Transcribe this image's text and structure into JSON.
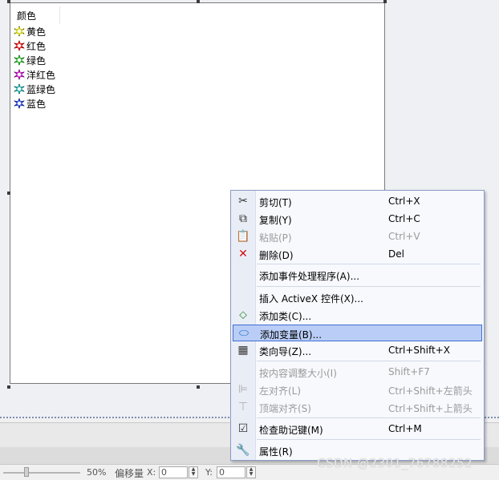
{
  "listbox": {
    "header": "颜色",
    "items": [
      {
        "label": "黄色",
        "color": "#c8c800"
      },
      {
        "label": "红色",
        "color": "#d00000"
      },
      {
        "label": "绿色",
        "color": "#1ea01e"
      },
      {
        "label": "洋红色",
        "color": "#b000b0"
      },
      {
        "label": "蓝绿色",
        "color": "#109898"
      },
      {
        "label": "蓝色",
        "color": "#1030c0"
      }
    ]
  },
  "context_menu": {
    "items": [
      {
        "label": "剪切(T)",
        "shortcut": "Ctrl+X",
        "icon": "scissors-icon",
        "enabled": true
      },
      {
        "label": "复制(Y)",
        "shortcut": "Ctrl+C",
        "icon": "copy-icon",
        "enabled": true
      },
      {
        "label": "粘贴(P)",
        "shortcut": "Ctrl+V",
        "icon": "paste-icon",
        "enabled": false
      },
      {
        "label": "删除(D)",
        "shortcut": "Del",
        "icon": "delete-x-icon",
        "enabled": true
      },
      {
        "label": "添加事件处理程序(A)...",
        "shortcut": "",
        "icon": "",
        "enabled": true
      },
      {
        "label": "插入 ActiveX 控件(X)...",
        "shortcut": "",
        "icon": "",
        "enabled": true
      },
      {
        "label": "添加类(C)...",
        "shortcut": "",
        "icon": "add-class-icon",
        "enabled": true
      },
      {
        "label": "添加变量(B)...",
        "shortcut": "",
        "icon": "add-variable-icon",
        "enabled": true,
        "highlighted": true
      },
      {
        "label": "类向导(Z)...",
        "shortcut": "Ctrl+Shift+X",
        "icon": "class-wizard-icon",
        "enabled": true
      },
      {
        "label": "按内容调整大小(I)",
        "shortcut": "Shift+F7",
        "icon": "",
        "enabled": false
      },
      {
        "label": "左对齐(L)",
        "shortcut": "Ctrl+Shift+左箭头",
        "icon": "align-left-icon",
        "enabled": false
      },
      {
        "label": "顶端对齐(S)",
        "shortcut": "Ctrl+Shift+上箭头",
        "icon": "align-top-icon",
        "enabled": false
      },
      {
        "label": "检查助记键(M)",
        "shortcut": "Ctrl+M",
        "icon": "checkbox-icon",
        "enabled": true
      },
      {
        "label": "属性(R)",
        "shortcut": "",
        "icon": "wrench-icon",
        "enabled": true
      }
    ]
  },
  "statusbar": {
    "zoom": "50%",
    "offset_label": "偏移量",
    "x_label": "X:",
    "x_value": "0",
    "y_label": "Y:",
    "y_value": "0"
  },
  "watermark": "CSDN @2301_76788252"
}
